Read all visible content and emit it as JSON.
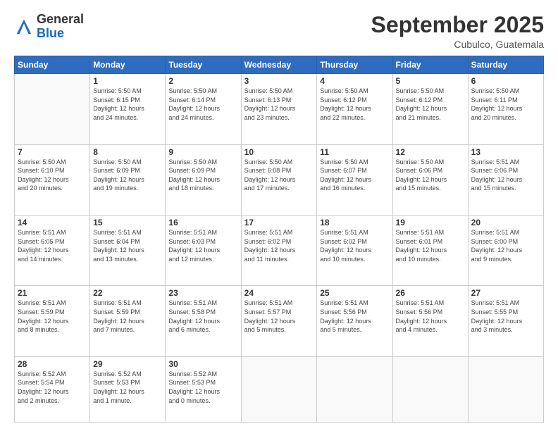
{
  "header": {
    "logo_general": "General",
    "logo_blue": "Blue",
    "month_title": "September 2025",
    "location": "Cubulco, Guatemala"
  },
  "weekdays": [
    "Sunday",
    "Monday",
    "Tuesday",
    "Wednesday",
    "Thursday",
    "Friday",
    "Saturday"
  ],
  "weeks": [
    [
      {
        "day": "",
        "info": ""
      },
      {
        "day": "1",
        "info": "Sunrise: 5:50 AM\nSunset: 6:15 PM\nDaylight: 12 hours\nand 24 minutes."
      },
      {
        "day": "2",
        "info": "Sunrise: 5:50 AM\nSunset: 6:14 PM\nDaylight: 12 hours\nand 24 minutes."
      },
      {
        "day": "3",
        "info": "Sunrise: 5:50 AM\nSunset: 6:13 PM\nDaylight: 12 hours\nand 23 minutes."
      },
      {
        "day": "4",
        "info": "Sunrise: 5:50 AM\nSunset: 6:12 PM\nDaylight: 12 hours\nand 22 minutes."
      },
      {
        "day": "5",
        "info": "Sunrise: 5:50 AM\nSunset: 6:12 PM\nDaylight: 12 hours\nand 21 minutes."
      },
      {
        "day": "6",
        "info": "Sunrise: 5:50 AM\nSunset: 6:11 PM\nDaylight: 12 hours\nand 20 minutes."
      }
    ],
    [
      {
        "day": "7",
        "info": ""
      },
      {
        "day": "8",
        "info": "Sunrise: 5:50 AM\nSunset: 6:09 PM\nDaylight: 12 hours\nand 19 minutes."
      },
      {
        "day": "9",
        "info": "Sunrise: 5:50 AM\nSunset: 6:09 PM\nDaylight: 12 hours\nand 18 minutes."
      },
      {
        "day": "10",
        "info": "Sunrise: 5:50 AM\nSunset: 6:08 PM\nDaylight: 12 hours\nand 17 minutes."
      },
      {
        "day": "11",
        "info": "Sunrise: 5:50 AM\nSunset: 6:07 PM\nDaylight: 12 hours\nand 16 minutes."
      },
      {
        "day": "12",
        "info": "Sunrise: 5:50 AM\nSunset: 6:06 PM\nDaylight: 12 hours\nand 15 minutes."
      },
      {
        "day": "13",
        "info": "Sunrise: 5:51 AM\nSunset: 6:06 PM\nDaylight: 12 hours\nand 15 minutes."
      }
    ],
    [
      {
        "day": "14",
        "info": ""
      },
      {
        "day": "15",
        "info": "Sunrise: 5:51 AM\nSunset: 6:04 PM\nDaylight: 12 hours\nand 13 minutes."
      },
      {
        "day": "16",
        "info": "Sunrise: 5:51 AM\nSunset: 6:03 PM\nDaylight: 12 hours\nand 12 minutes."
      },
      {
        "day": "17",
        "info": "Sunrise: 5:51 AM\nSunset: 6:02 PM\nDaylight: 12 hours\nand 11 minutes."
      },
      {
        "day": "18",
        "info": "Sunrise: 5:51 AM\nSunset: 6:02 PM\nDaylight: 12 hours\nand 10 minutes."
      },
      {
        "day": "19",
        "info": "Sunrise: 5:51 AM\nSunset: 6:01 PM\nDaylight: 12 hours\nand 10 minutes."
      },
      {
        "day": "20",
        "info": "Sunrise: 5:51 AM\nSunset: 6:00 PM\nDaylight: 12 hours\nand 9 minutes."
      }
    ],
    [
      {
        "day": "21",
        "info": ""
      },
      {
        "day": "22",
        "info": "Sunrise: 5:51 AM\nSunset: 5:59 PM\nDaylight: 12 hours\nand 7 minutes."
      },
      {
        "day": "23",
        "info": "Sunrise: 5:51 AM\nSunset: 5:58 PM\nDaylight: 12 hours\nand 6 minutes."
      },
      {
        "day": "24",
        "info": "Sunrise: 5:51 AM\nSunset: 5:57 PM\nDaylight: 12 hours\nand 5 minutes."
      },
      {
        "day": "25",
        "info": "Sunrise: 5:51 AM\nSunset: 5:56 PM\nDaylight: 12 hours\nand 5 minutes."
      },
      {
        "day": "26",
        "info": "Sunrise: 5:51 AM\nSunset: 5:56 PM\nDaylight: 12 hours\nand 4 minutes."
      },
      {
        "day": "27",
        "info": "Sunrise: 5:51 AM\nSunset: 5:55 PM\nDaylight: 12 hours\nand 3 minutes."
      }
    ],
    [
      {
        "day": "28",
        "info": "Sunrise: 5:52 AM\nSunset: 5:54 PM\nDaylight: 12 hours\nand 2 minutes."
      },
      {
        "day": "29",
        "info": "Sunrise: 5:52 AM\nSunset: 5:53 PM\nDaylight: 12 hours\nand 1 minute."
      },
      {
        "day": "30",
        "info": "Sunrise: 5:52 AM\nSunset: 5:53 PM\nDaylight: 12 hours\nand 0 minutes."
      },
      {
        "day": "",
        "info": ""
      },
      {
        "day": "",
        "info": ""
      },
      {
        "day": "",
        "info": ""
      },
      {
        "day": "",
        "info": ""
      }
    ]
  ],
  "week1_sun_info": "Sunrise: 5:50 AM\nSunset: 6:10 PM\nDaylight: 12 hours\nand 20 minutes.",
  "week2_sun_info": "Sunrise: 5:51 AM\nSunset: 6:05 PM\nDaylight: 12 hours\nand 14 minutes.",
  "week3_sun_info": "Sunrise: 5:51 AM\nSunset: 5:59 PM\nDaylight: 12 hours\nand 8 minutes.",
  "week4_sun_info": "Sunrise: 5:51 AM\nSunset: 5:59 PM\nDaylight: 12 hours\nand 8 minutes."
}
